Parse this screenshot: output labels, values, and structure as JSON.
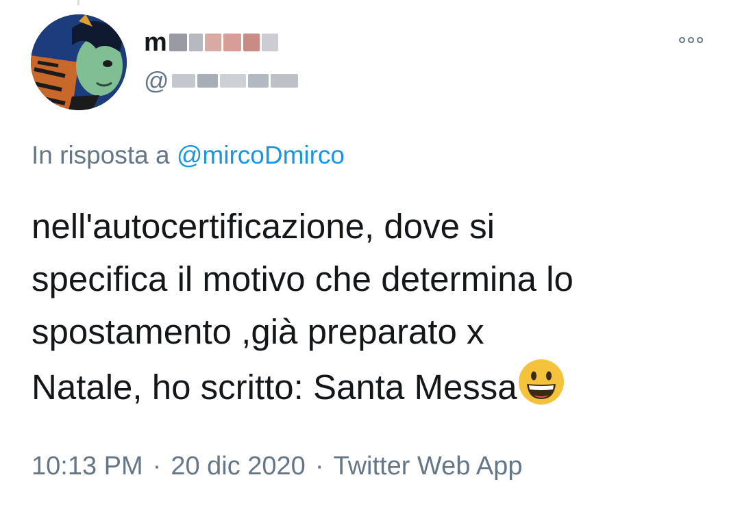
{
  "tweet": {
    "author": {
      "display_name_visible": "m",
      "handle_visible": "@",
      "avatar_icon": "avatar-icon"
    },
    "more_icon": "more-options-icon",
    "reply": {
      "prefix": "In risposta a",
      "mention": "@mircoDmirco"
    },
    "text_lines": [
      "nell'autocertificazione, dove si",
      "specifica il motivo che determina lo",
      "spostamento ,già preparato x",
      "Natale, ho scritto:  Santa Messa"
    ],
    "emoji_icon": "grinning-face-emoji",
    "meta": {
      "time": "10:13 PM",
      "separator": "·",
      "date": "20 dic 2020",
      "source": "Twitter Web App"
    },
    "colors": {
      "text": "#14171a",
      "secondary": "#657786",
      "link": "#1b95e0",
      "emoji": "#f5c33b"
    }
  }
}
